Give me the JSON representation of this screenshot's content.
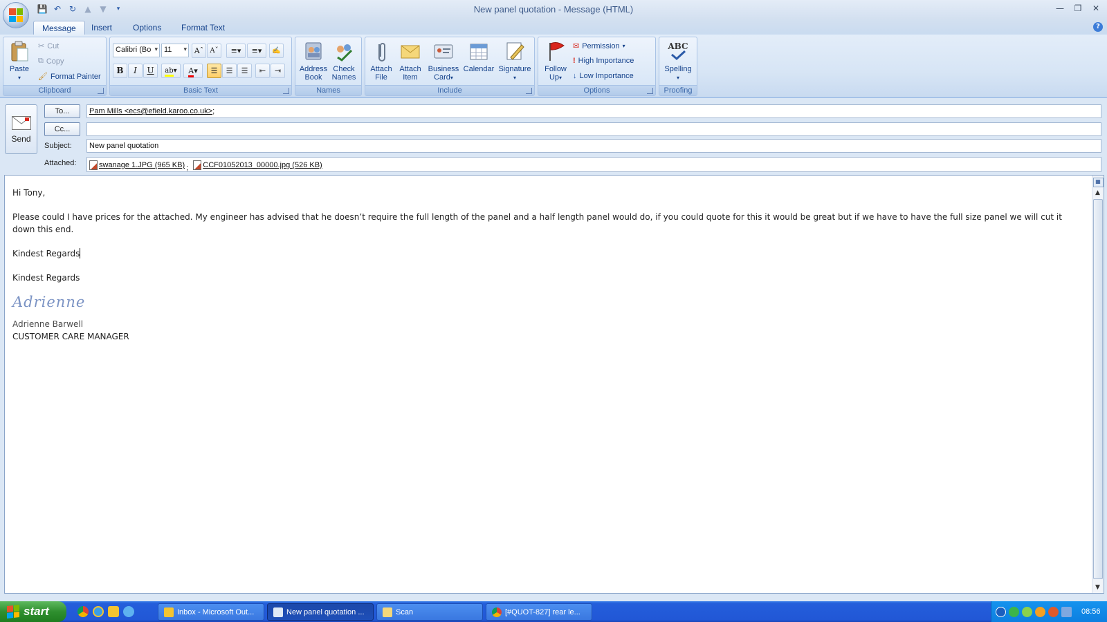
{
  "window": {
    "title": "New panel quotation - Message (HTML)",
    "controls": [
      "minimize",
      "restore",
      "close"
    ]
  },
  "quick_access": [
    "save-icon",
    "undo-icon",
    "redo-icon",
    "previous-item-icon",
    "next-item-icon",
    "customize-icon"
  ],
  "tabs": [
    {
      "label": "Message",
      "active": true
    },
    {
      "label": "Insert",
      "active": false
    },
    {
      "label": "Options",
      "active": false
    },
    {
      "label": "Format Text",
      "active": false
    }
  ],
  "ribbon": {
    "clipboard": {
      "label": "Clipboard",
      "paste": "Paste",
      "cut": "Cut",
      "copy": "Copy",
      "format_painter": "Format Painter"
    },
    "basic_text": {
      "label": "Basic Text",
      "font": "Calibri (Bo",
      "size": "11",
      "bold": "B",
      "italic": "I",
      "underline": "U"
    },
    "names": {
      "label": "Names",
      "address_book_1": "Address",
      "address_book_2": "Book",
      "check_names_1": "Check",
      "check_names_2": "Names"
    },
    "include": {
      "label": "Include",
      "attach_file_1": "Attach",
      "attach_file_2": "File",
      "attach_item_1": "Attach",
      "attach_item_2": "Item",
      "business_card_1": "Business",
      "business_card_2": "Card",
      "calendar": "Calendar",
      "signature": "Signature"
    },
    "options": {
      "label": "Options",
      "follow_up_1": "Follow",
      "follow_up_2": "Up",
      "permission": "Permission",
      "high_importance": "High Importance",
      "low_importance": "Low Importance"
    },
    "proofing": {
      "label": "Proofing",
      "spelling": "Spelling",
      "abc": "ABC"
    }
  },
  "header": {
    "send": "Send",
    "to_button": "To...",
    "cc_button": "Cc...",
    "subject_label": "Subject:",
    "attached_label": "Attached:",
    "to_value": "Pam Mills <ecs@efield.karoo.co.uk>",
    "to_separator": ";",
    "cc_value": "",
    "subject_value": "New panel quotation",
    "attachments": [
      {
        "name": "swanage 1.JPG (965 KB)",
        "separator": ";"
      },
      {
        "name": "CCF01052013_00000.jpg (526 KB)",
        "separator": ""
      }
    ]
  },
  "body": {
    "greeting": "Hi Tony,",
    "paragraph": "Please could I have prices for the attached.  My engineer has advised that he doesn’t require the full length of the panel and a half length panel would do, if you could quote for this it would be great but if we have to have the full size panel we will cut it down this end.",
    "closing_1": "Kindest Regards",
    "closing_2": "Kindest Regards",
    "signature_script": "Adrienne",
    "signature_name": "Adrienne Barwell",
    "signature_title": "CUSTOMER CARE MANAGER"
  },
  "taskbar": {
    "start": "start",
    "tasks": [
      {
        "label": "Inbox - Microsoft Out...",
        "active": false,
        "icon": "outlook-icon"
      },
      {
        "label": "New panel quotation ...",
        "active": true,
        "icon": "message-icon"
      },
      {
        "label": "Scan",
        "active": false,
        "icon": "folder-icon"
      },
      {
        "label": "[#QUOT-827] rear le...",
        "active": false,
        "icon": "chrome-icon"
      }
    ],
    "clock": "08:56"
  },
  "colors": {
    "ribbon_bg": "#d7e5f5",
    "taskbar_blue": "#245edb",
    "start_green": "#2f8f2f",
    "signature_blue": "#7b93c4"
  }
}
